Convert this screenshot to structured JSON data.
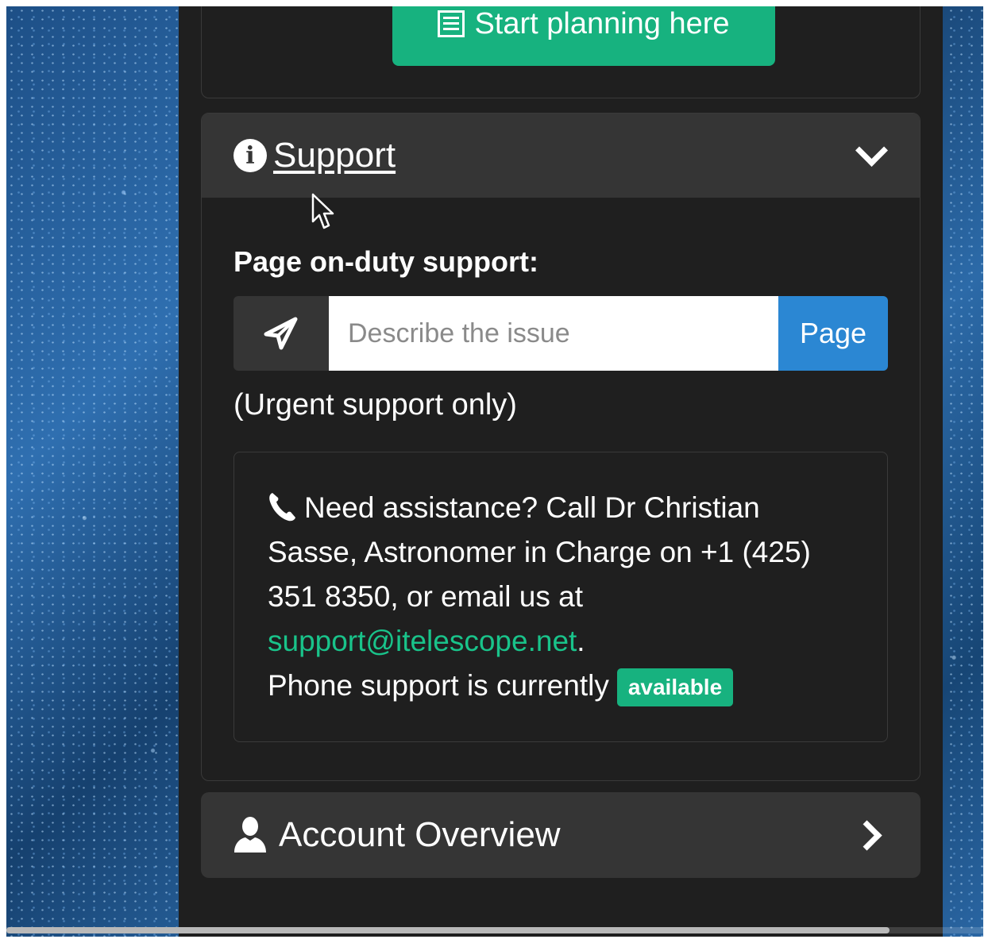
{
  "planning": {
    "button_label": "Start planning here",
    "icon": "list-icon"
  },
  "support": {
    "title": "Support",
    "icons": {
      "info": "info-circle-icon",
      "toggle": "chevron-down-icon"
    },
    "page_label": "Page on-duty support:",
    "issue_placeholder": "Describe the issue",
    "page_button": "Page",
    "urgent_note": "(Urgent support only)",
    "assistance": {
      "text_line": "Need assistance? Call Dr Christian Sasse, Astronomer in Charge on +1 (425) 351 8350, or email us at",
      "email": "support@itelescope.net",
      "period": ".",
      "status_prefix": "Phone support is currently",
      "status_badge": "available"
    }
  },
  "account": {
    "title": "Account Overview",
    "icons": {
      "user": "user-icon",
      "toggle": "chevron-right-icon"
    }
  },
  "colors": {
    "accent_green": "#17b27f",
    "link_green": "#19c38a",
    "page_blue": "#2b87d3",
    "panel_bg": "#1f1f1f",
    "header_bg": "#353535"
  }
}
